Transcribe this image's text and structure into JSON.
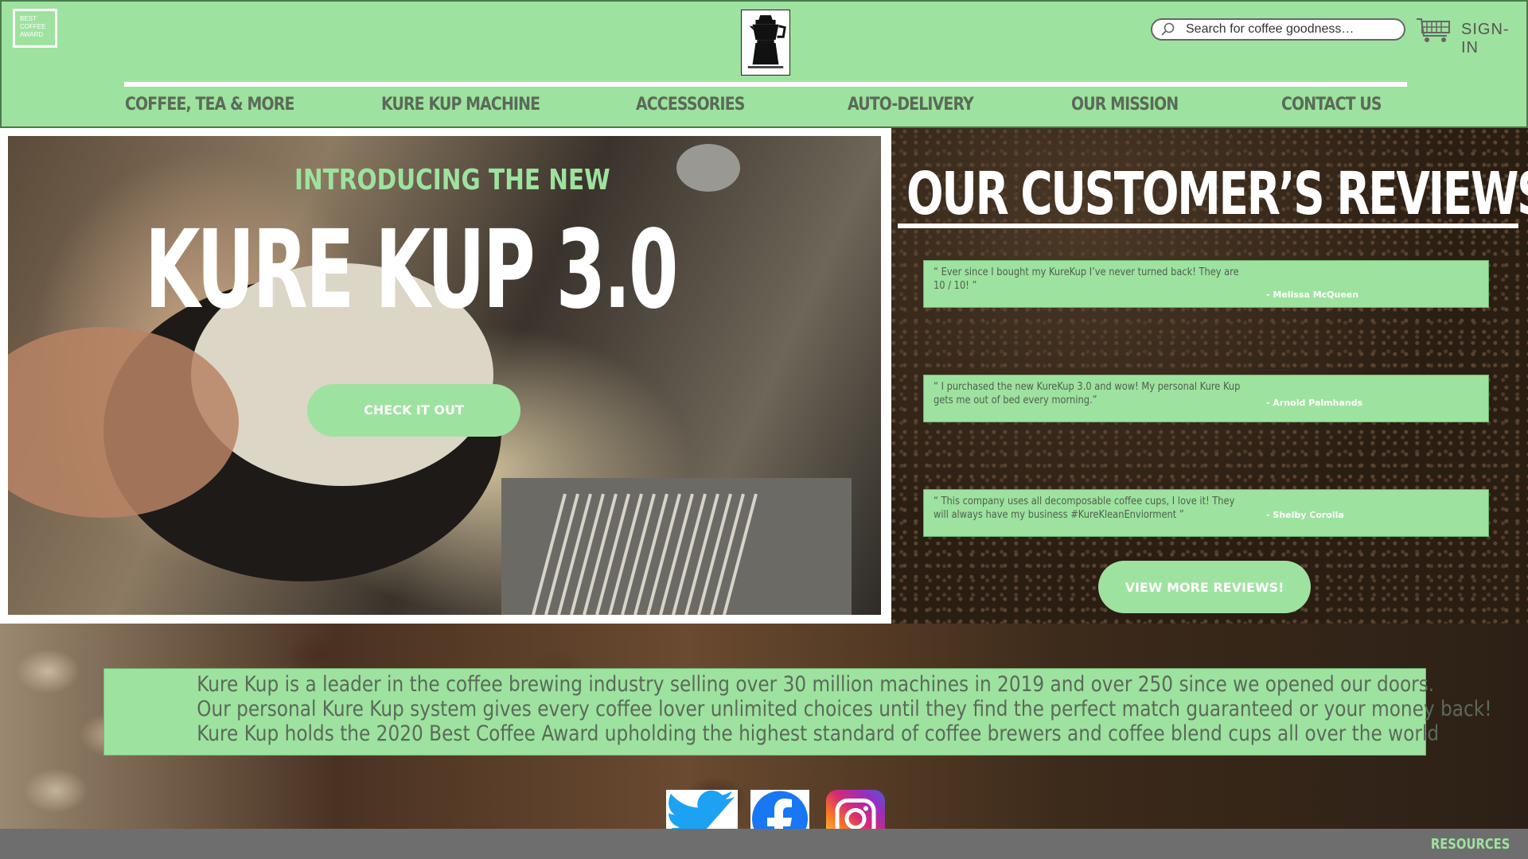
{
  "header": {
    "award_badge": [
      "BEST",
      "COFFEE",
      "AWARD"
    ],
    "logo_icon": "moka-pot-icon",
    "search": {
      "placeholder": "Search for coffee goodness…",
      "icon": "search-icon"
    },
    "cart_icon": "cart-icon",
    "signin_label": "SIGN-IN"
  },
  "nav": {
    "items": [
      {
        "label": "COFFEE, TEA & MORE"
      },
      {
        "label": "KURE KUP MACHINE"
      },
      {
        "label": "ACCESSORIES"
      },
      {
        "label": "AUTO-DELIVERY"
      },
      {
        "label": "OUR MISSION"
      },
      {
        "label": "CONTACT US"
      }
    ]
  },
  "hero": {
    "intro": "INTRODUCING THE NEW",
    "title": "KURE KUP 3.0",
    "cta_label": "CHECK IT OUT"
  },
  "reviews": {
    "title": "OUR CUSTOMER’S REVIEWS!",
    "items": [
      {
        "quote": "“ Ever since I bought my KureKup I’ve never turned back! They are 10 / 10! ”",
        "author": "- Melissa McQueen"
      },
      {
        "quote": "“ I purchased the new KureKup 3.0 and wow!  My personal Kure Kup gets me out of bed every morning.”",
        "author": "- Arnold Palmhands"
      },
      {
        "quote": "“ This company uses all decomposable coffee cups, I love it! They will always have my business #KureKleanEnviorment ”",
        "author": "- Shelby Corolla"
      }
    ],
    "view_more_label": "VIEW MORE REVIEWS!"
  },
  "about": {
    "lines": [
      "Kure Kup is a leader in the coffee brewing industry selling over 30 million machines in 2019 and over 250 since we opened our doors.",
      "Our personal Kure Kup system gives every coffee lover unlimited choices until they find the perfect match guaranteed or your money back!",
      "Kure Kup holds the 2020 Best Coffee Award upholding the highest standard of coffee brewers and coffee blend cups all over the world"
    ]
  },
  "social": [
    "twitter-icon",
    "facebook-icon",
    "instagram-icon"
  ],
  "footer": {
    "resources_label": "RESOURCES"
  },
  "colors": {
    "brand_green": "#9ee29f",
    "nav_text": "#5a6a5a",
    "footer_gray": "#6e6e6e",
    "twitter_blue": "#1da1f2",
    "facebook_blue": "#1877f2"
  }
}
